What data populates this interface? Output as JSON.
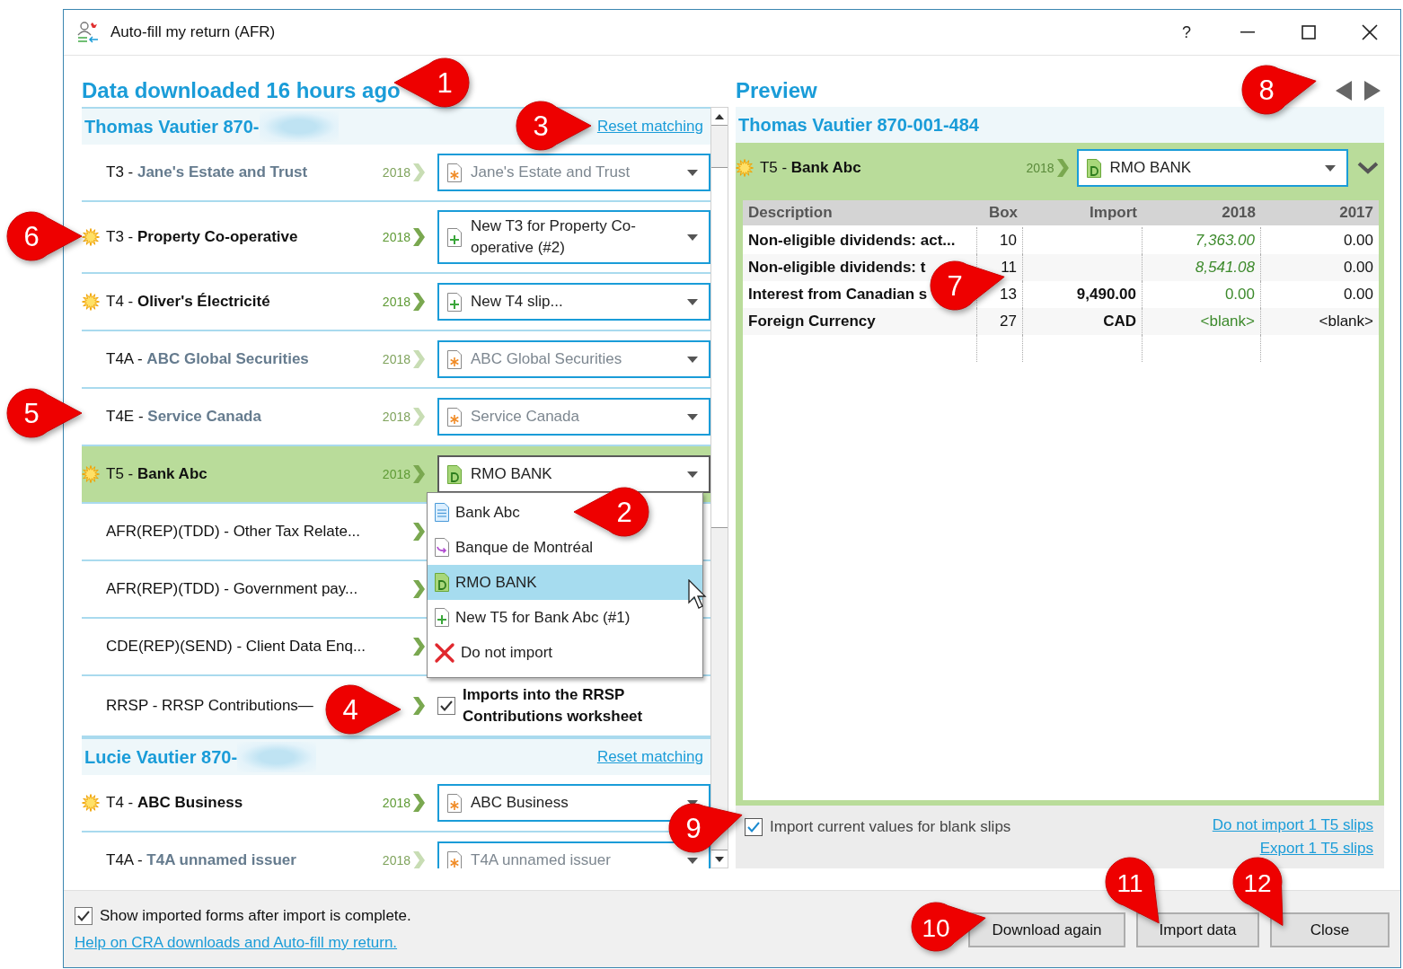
{
  "window": {
    "title": "Auto-fill my return (AFR)",
    "help": "?"
  },
  "left": {
    "heading": "Data downloaded 16 hours ago",
    "sections": [
      {
        "person": "Thomas Vautier 870-",
        "redacted": true,
        "reset": "Reset matching",
        "rows": [
          {
            "kind": "slip",
            "title": "T3 - **Jane's Estate and Trust**",
            "dimmed": true,
            "starred": false,
            "selected": false,
            "year": "2018",
            "select": {
              "text": "Jane's Estate and Trust",
              "kind": "asterisk"
            }
          },
          {
            "kind": "slip",
            "title": "T3 - **Property Co-operative**",
            "dimmed": false,
            "starred": true,
            "selected": false,
            "year": "2018",
            "select": {
              "text": "New T3 for Property Co-operative (#2)",
              "kind": "plus"
            }
          },
          {
            "kind": "slip",
            "title": "T4 - **Oliver's Électricité**",
            "dimmed": false,
            "starred": true,
            "selected": false,
            "year": "2018",
            "select": {
              "text": "New T4 slip...",
              "kind": "plus"
            }
          },
          {
            "kind": "slip",
            "title": "T4A - **ABC Global Securities**",
            "dimmed": true,
            "starred": false,
            "selected": false,
            "year": "2018",
            "select": {
              "text": "ABC Global Securities",
              "kind": "asterisk"
            }
          },
          {
            "kind": "slip",
            "title": "T4E - **Service Canada**",
            "dimmed": true,
            "starred": false,
            "selected": false,
            "year": "2018",
            "select": {
              "text": "Service Canada",
              "kind": "asterisk"
            }
          },
          {
            "kind": "slip",
            "title": "T5 - **Bank Abc**",
            "dimmed": false,
            "starred": true,
            "selected": true,
            "year": "2018",
            "select": {
              "text": "RMO BANK",
              "kind": "data",
              "open": true,
              "options": [
                {
                  "text": "Bank Abc",
                  "kind": "lines",
                  "selected": false
                },
                {
                  "text": "Banque de Montréal",
                  "kind": "arrow",
                  "selected": false
                },
                {
                  "text": "RMO BANK",
                  "kind": "data",
                  "selected": true
                },
                {
                  "text": "New T5 for Bank Abc (#1)",
                  "kind": "plus",
                  "selected": false
                },
                {
                  "text": "Do not import",
                  "kind": "cross",
                  "selected": false
                }
              ]
            }
          },
          {
            "kind": "slip",
            "title": "AFR(REP)(TDD) - Other Tax Relate...",
            "starred": false,
            "selected": false
          },
          {
            "kind": "slip",
            "title": "AFR(REP)(TDD) - Government pay...",
            "starred": false,
            "selected": false
          },
          {
            "kind": "slip",
            "title": "CDE(REP)(SEND) - Client Data Enq...",
            "starred": false,
            "selected": false
          },
          {
            "kind": "checkbox",
            "title": "RRSP - RRSP Contributions—",
            "starred": false,
            "selected": false,
            "checked": true,
            "label": "Imports into the RRSP Contributions worksheet"
          }
        ]
      },
      {
        "person": "Lucie Vautier 870-",
        "redacted": true,
        "reset": "Reset matching",
        "rows": [
          {
            "kind": "slip",
            "title": "T4 - **ABC Business**",
            "dimmed": false,
            "starred": true,
            "selected": false,
            "year": "2018",
            "select": {
              "text": "ABC Business",
              "kind": "asterisk"
            }
          },
          {
            "kind": "slip",
            "title": "T4A - **T4A unnamed issuer**",
            "dimmed": true,
            "starred": false,
            "selected": false,
            "year": "2018",
            "select": {
              "text": "T4A unnamed issuer",
              "kind": "asterisk"
            }
          }
        ]
      }
    ]
  },
  "preview": {
    "heading": "Preview",
    "person": "Thomas Vautier 870-001-484",
    "slip": {
      "title": "T5 - **Bank Abc**",
      "starred": true,
      "year": "2018",
      "select": {
        "text": "RMO BANK",
        "kind": "data"
      }
    },
    "columns": [
      "Description",
      "Box",
      "Import",
      "2018",
      "2017"
    ],
    "rows": [
      {
        "cells": [
          "Non-eligible dividends: act...",
          "10",
          "",
          "7,363.00",
          "0.00"
        ],
        "changed": true
      },
      {
        "cells": [
          "Non-eligible dividends: t",
          "11",
          "",
          "8,541.08",
          "0.00"
        ],
        "changed": true
      },
      {
        "cells": [
          "Interest from Canadian s",
          "13",
          "9,490.00",
          "0.00",
          "0.00"
        ],
        "changed": false
      },
      {
        "cells": [
          "Foreign Currency",
          "27",
          "CAD",
          "<blank>",
          "<blank>"
        ],
        "changed": false
      }
    ],
    "blank_option": {
      "label": "Import current values for blank slips",
      "checked": true
    },
    "links": [
      "Do not import 1 T5 slips",
      "Export 1 T5 slips"
    ]
  },
  "footer": {
    "show_imported": {
      "label": "Show imported forms after import is complete.",
      "checked": true
    },
    "help_link": "Help on CRA downloads and Auto-fill my return.",
    "buttons": [
      "Download again",
      "Import data",
      "Close"
    ]
  },
  "callouts": [
    "1",
    "2",
    "3",
    "4",
    "5",
    "6",
    "7",
    "8",
    "9",
    "10",
    "11",
    "12"
  ]
}
